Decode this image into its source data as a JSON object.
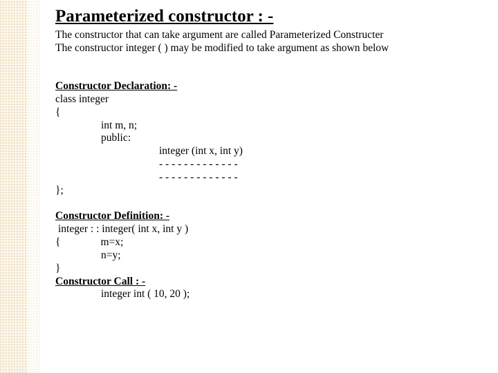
{
  "title": "Parameterized constructor : -",
  "intro": {
    "line1": "The constructor that can take argument are called Parameterized Constructer",
    "line2": "The constructor integer ( ) may be modified to take argument as shown below"
  },
  "decl": {
    "heading": "Constructor Declaration: -",
    "l1": "class integer",
    "l2": "{",
    "l3": "int m, n;",
    "l4": "public:",
    "l5": "integer (int x, int y)",
    "l6": "- - - - - - - - - - - - -",
    "l7": "- - - - - - - - - - - - -",
    "l8": "};"
  },
  "def": {
    "heading": "Constructor Definition: -",
    "l1": " integer : : integer( int x, int y )",
    "l2": "{",
    "l2b": "m=x;",
    "l3": "n=y;",
    "l4": "}"
  },
  "call": {
    "heading": "Constructor Call : -",
    "l1": "integer int ( 10, 20 );"
  }
}
